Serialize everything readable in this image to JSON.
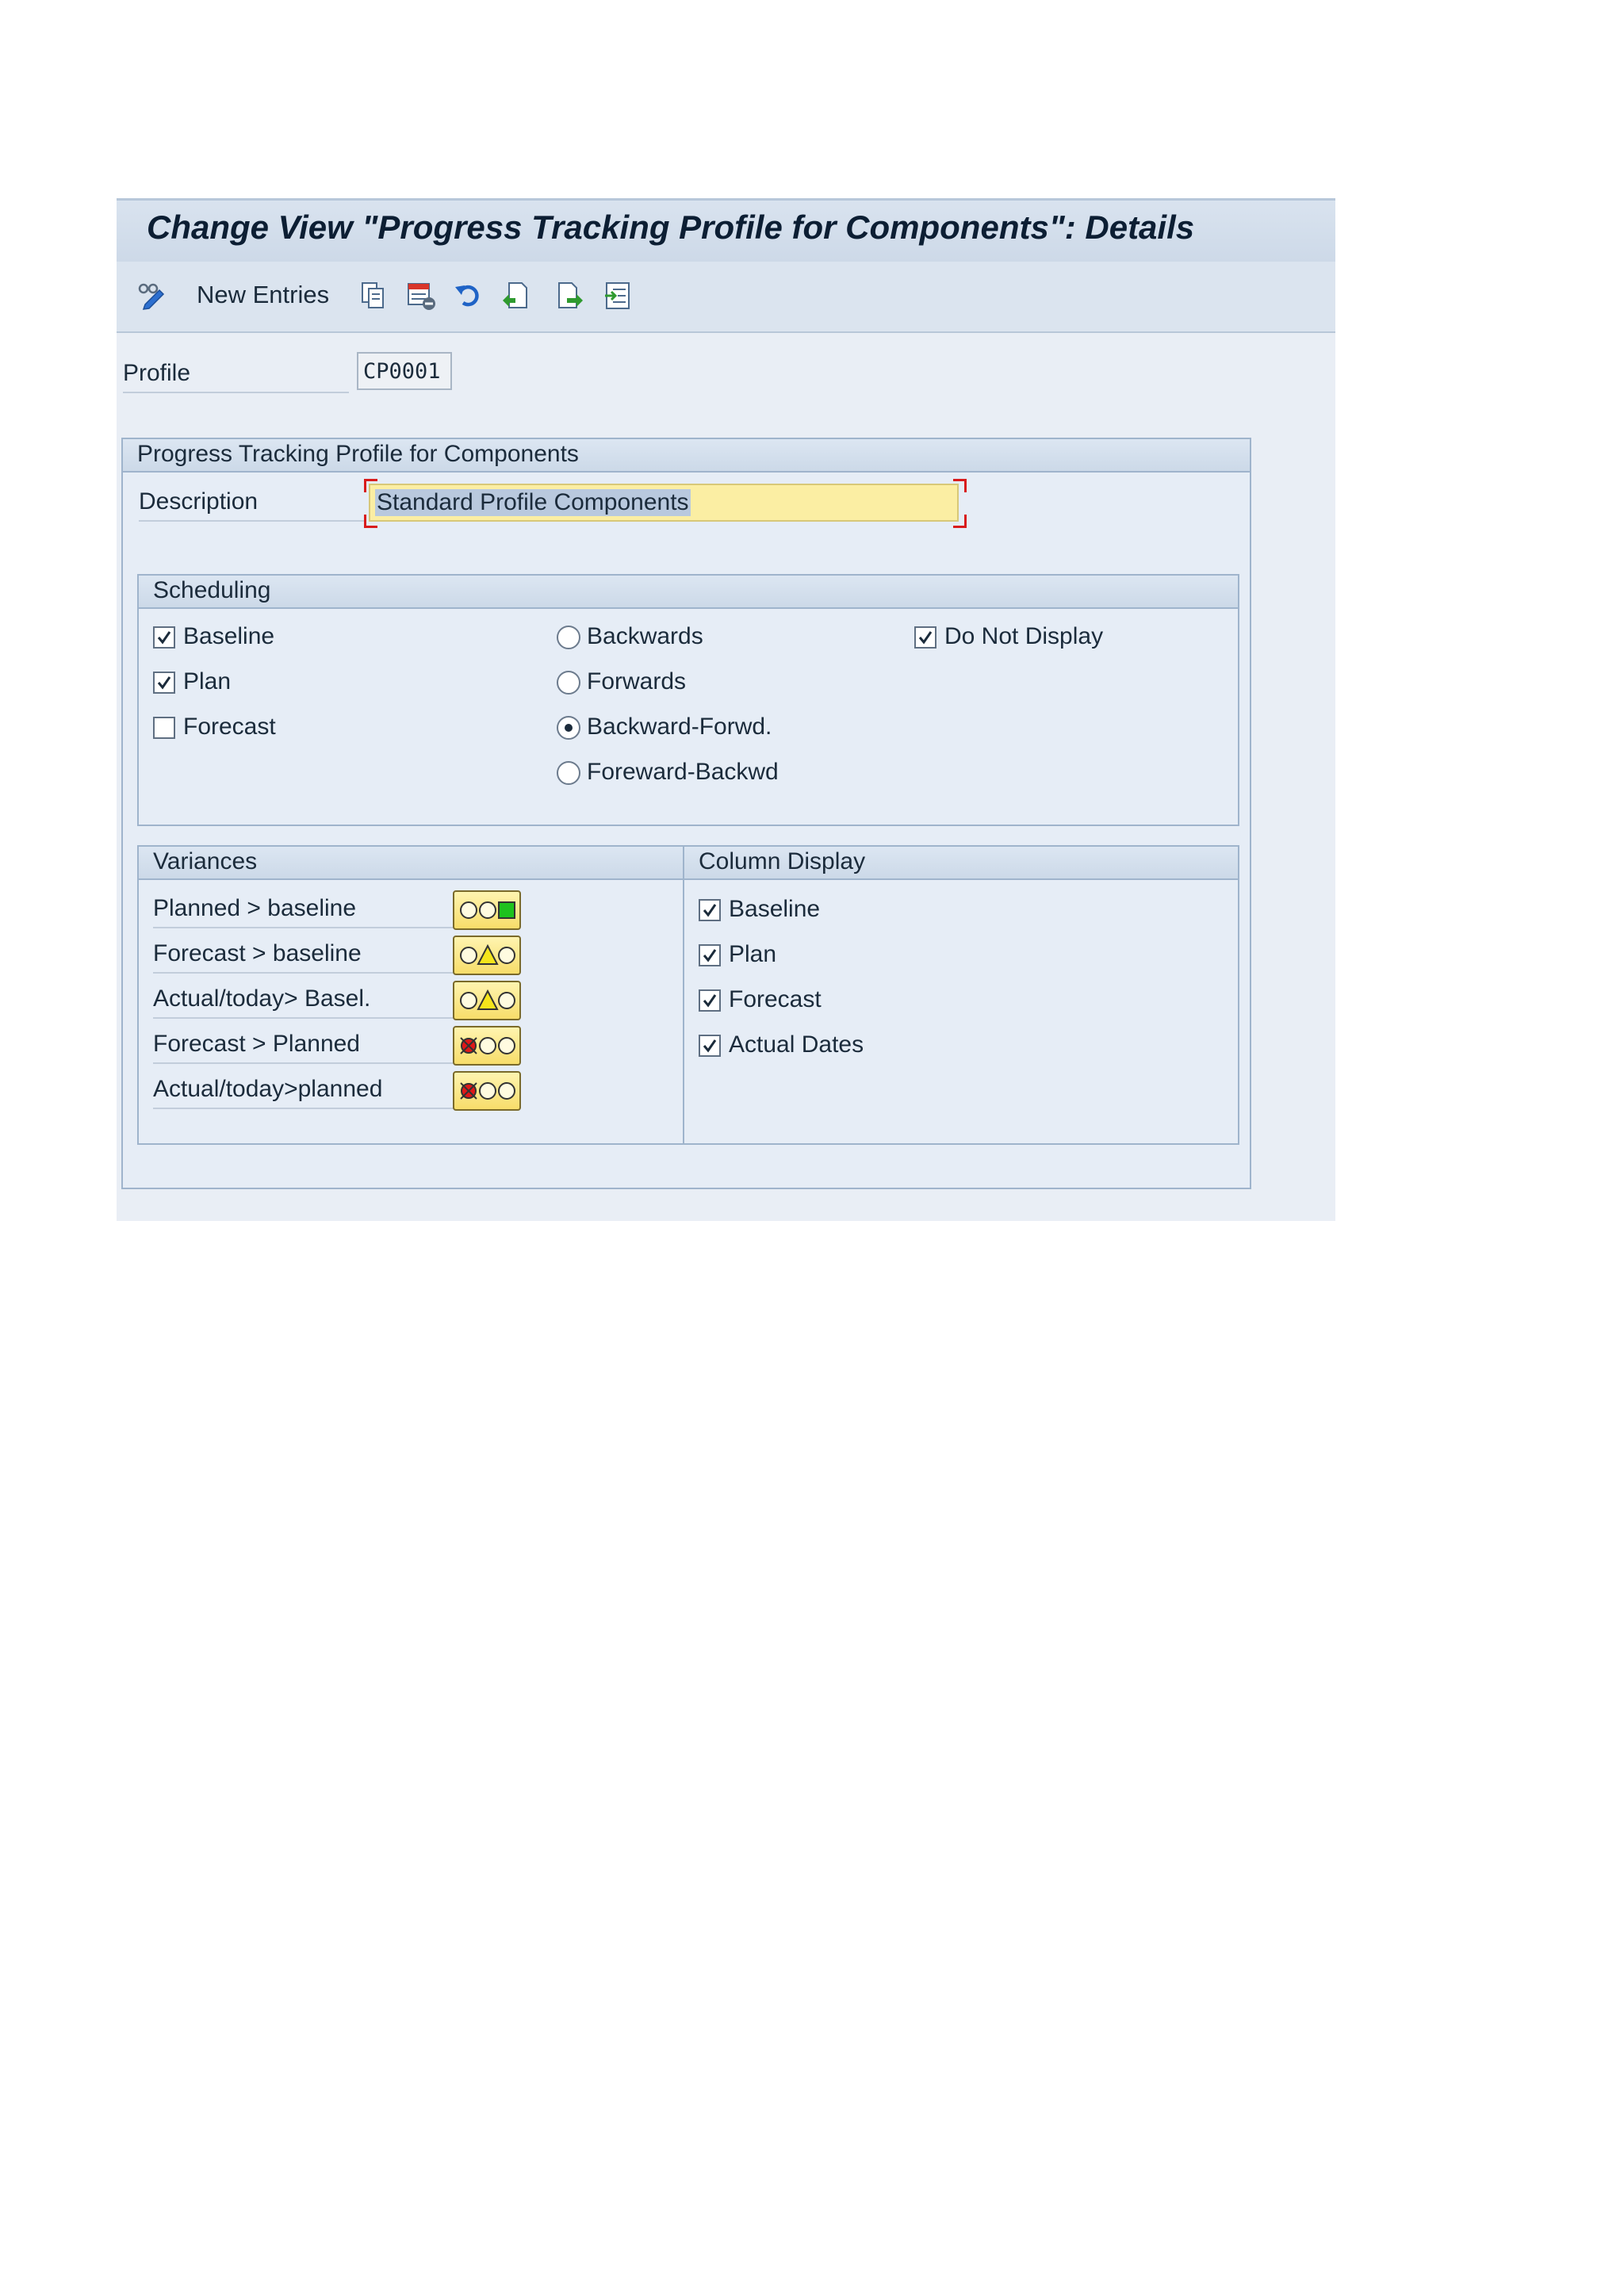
{
  "title": "Change View \"Progress Tracking Profile for Components\": Details",
  "toolbar": {
    "new_entries_label": "New Entries",
    "icons": [
      "display-change-icon",
      "copy-as-icon",
      "delete-icon",
      "undo-icon",
      "previous-entry-icon",
      "next-entry-icon",
      "select-icon"
    ]
  },
  "profile": {
    "label": "Profile",
    "value": "CP0001"
  },
  "main_group": {
    "title": "Progress Tracking Profile for Components",
    "description_label": "Description",
    "description_value": "Standard Profile Components"
  },
  "scheduling": {
    "title": "Scheduling",
    "checkboxes": [
      {
        "label": "Baseline",
        "checked": true
      },
      {
        "label": "Plan",
        "checked": true
      },
      {
        "label": "Forecast",
        "checked": false
      }
    ],
    "radios": [
      {
        "label": "Backwards",
        "selected": false
      },
      {
        "label": "Forwards",
        "selected": false
      },
      {
        "label": "Backward-Forwd.",
        "selected": true
      },
      {
        "label": "Foreward-Backwd",
        "selected": false
      }
    ],
    "do_not_display": {
      "label": "Do Not Display",
      "checked": true
    }
  },
  "variances": {
    "title": "Variances",
    "rows": [
      {
        "label": "Planned > baseline",
        "status": "green"
      },
      {
        "label": "Forecast > baseline",
        "status": "yellow"
      },
      {
        "label": "Actual/today> Basel.",
        "status": "yellow"
      },
      {
        "label": "Forecast > Planned",
        "status": "red"
      },
      {
        "label": "Actual/today>planned",
        "status": "red"
      }
    ]
  },
  "column_display": {
    "title": "Column Display",
    "checkboxes": [
      {
        "label": "Baseline",
        "checked": true
      },
      {
        "label": "Plan",
        "checked": true
      },
      {
        "label": "Forecast",
        "checked": true
      },
      {
        "label": "Actual Dates",
        "checked": true
      }
    ]
  },
  "colors": {
    "status_green": "#1ec21e",
    "status_yellow": "#f5e51b",
    "status_red": "#e01818",
    "input_focus": "#fbeea3"
  }
}
